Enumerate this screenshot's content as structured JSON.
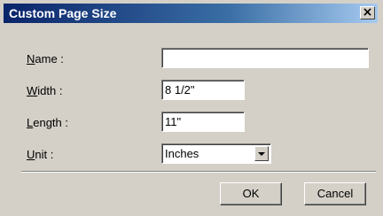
{
  "window": {
    "title": "Custom Page Size",
    "close_glyph": "✕"
  },
  "fields": {
    "name": {
      "label_accel": "N",
      "label_rest": "ame :",
      "value": ""
    },
    "width": {
      "label_accel": "W",
      "label_rest": "idth :",
      "value": "8 1/2\""
    },
    "length": {
      "label_accel": "L",
      "label_rest": "ength :",
      "value": "11\""
    },
    "unit": {
      "label_accel": "U",
      "label_rest": "nit :",
      "value": "Inches"
    }
  },
  "buttons": {
    "ok": "OK",
    "cancel": "Cancel"
  }
}
